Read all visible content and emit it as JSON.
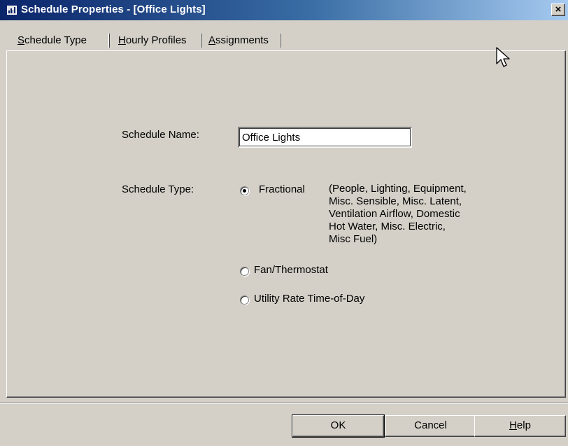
{
  "window": {
    "title": "Schedule Properties - [Office Lights]",
    "close_label": "×"
  },
  "tabs": [
    {
      "label": "Schedule Type",
      "accel": "S",
      "rest": "chedule Type",
      "active": true
    },
    {
      "label": "Hourly Profiles",
      "accel": "H",
      "rest": "ourly Profiles",
      "active": false
    },
    {
      "label": "Assignments",
      "accel": "A",
      "rest": "ssignments",
      "active": false
    }
  ],
  "form": {
    "name_label": "Schedule Name:",
    "name_value": "Office Lights",
    "type_label": "Schedule Type:",
    "options": [
      {
        "label": "Fractional",
        "selected": true
      },
      {
        "label": "Fan/Thermostat",
        "selected": false
      },
      {
        "label": "Utility Rate Time-of-Day",
        "selected": false
      }
    ],
    "fractional_description": [
      "(People, Lighting, Equipment,",
      "Misc. Sensible, Misc. Latent,",
      "Ventilation Airflow, Domestic",
      "Hot Water, Misc. Electric,",
      "Misc Fuel)"
    ]
  },
  "buttons": {
    "ok": "OK",
    "cancel": "Cancel",
    "help_accel": "H",
    "help_rest": "elp"
  },
  "colors": {
    "dialog_background": "#d4d0c8",
    "title_bar_start": "#0a246a",
    "title_bar_end": "#a6caf0"
  }
}
